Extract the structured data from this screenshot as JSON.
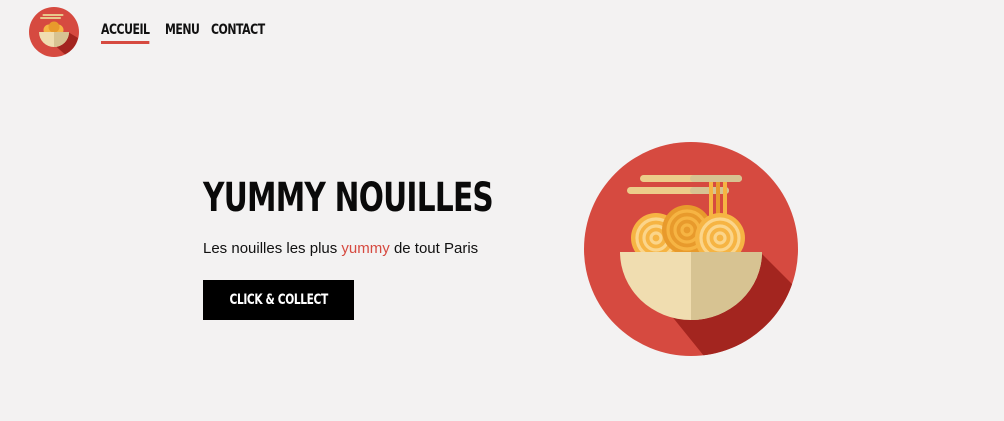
{
  "logo": {
    "icon": "noodle-bowl-icon",
    "accent_color": "#d64a40"
  },
  "nav": {
    "items": [
      {
        "label": "ACCUEIL",
        "active": true
      },
      {
        "label": "MENU",
        "active": false
      },
      {
        "label": "CONTACT",
        "active": false
      }
    ]
  },
  "hero": {
    "title": "YUMMY NOUILLES",
    "tagline_before": "Les nouilles les plus",
    "tagline_accent": "yummy",
    "tagline_after": "de tout Paris",
    "cta_label": "CLICK & COLLECT",
    "illustration": "noodle-bowl-icon"
  },
  "colors": {
    "accent": "#d64a40",
    "background": "#f3f2f2",
    "button": "#000000",
    "noodle": "#f6b443",
    "bowl": "#f0ddb0"
  }
}
